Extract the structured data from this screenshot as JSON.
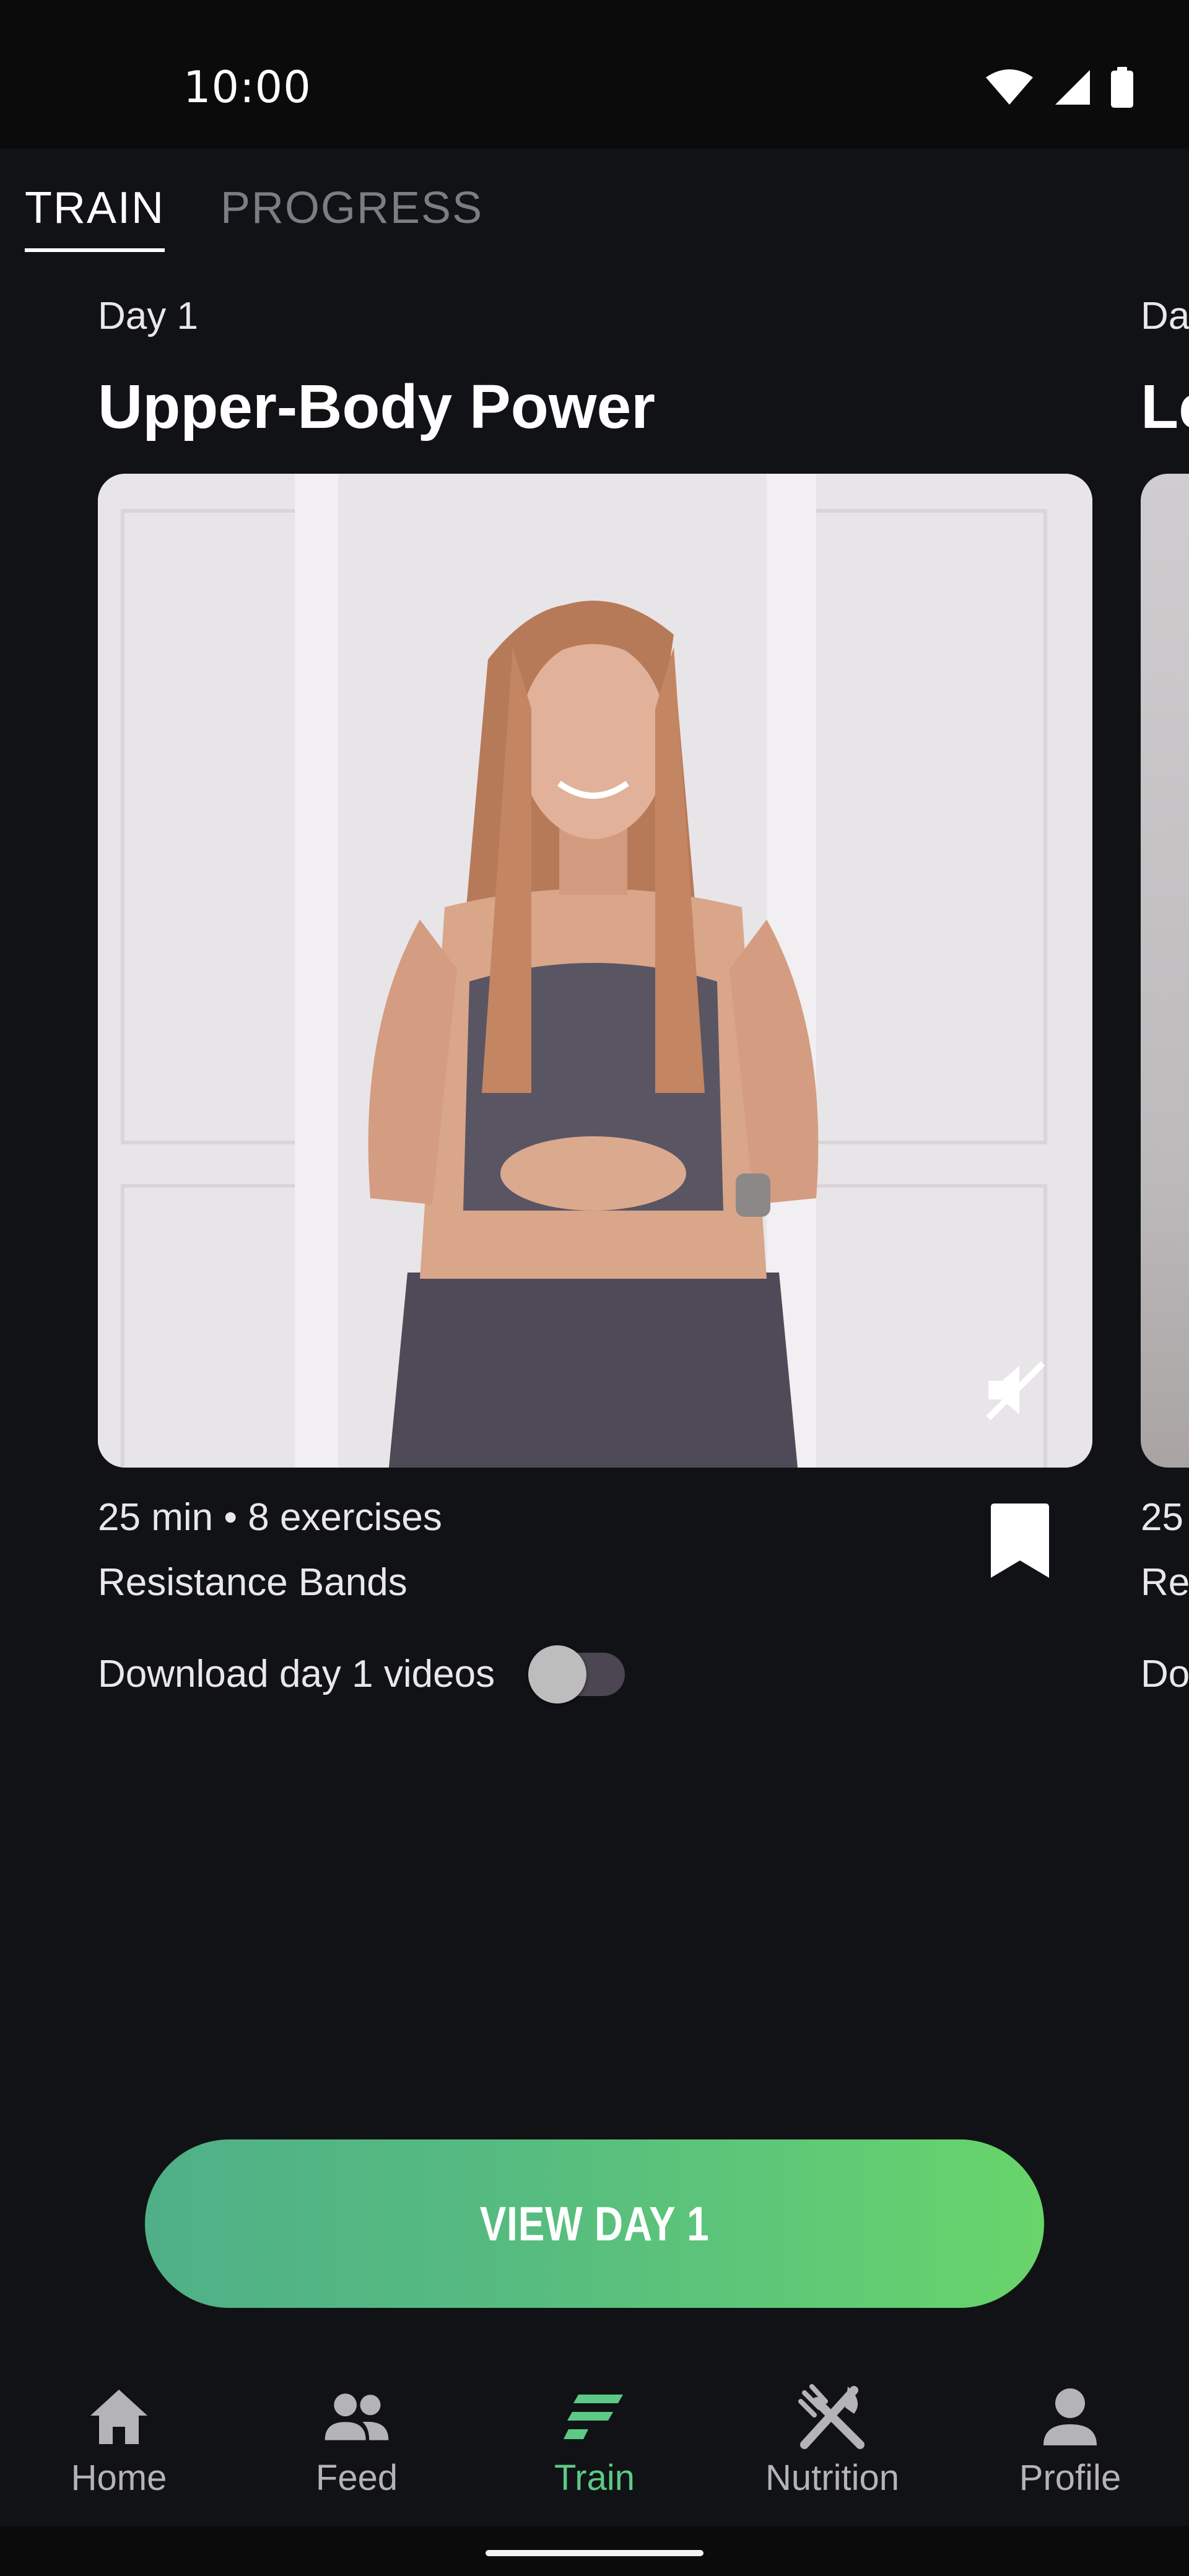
{
  "status_bar": {
    "time": "10:00",
    "icons": [
      "wifi-icon",
      "signal-icon",
      "battery-icon"
    ]
  },
  "top_tabs": [
    {
      "label": "TRAIN",
      "active": true
    },
    {
      "label": "PROGRESS",
      "active": false
    }
  ],
  "card": {
    "day_label": "Day 1",
    "title": "Upper-Body Power",
    "meta_duration": "25 min • 8 exercises",
    "meta_equipment": "Resistance Bands",
    "download_label": "Download day 1 videos",
    "download_enabled": false,
    "muted_icon": "volume-off-icon",
    "bookmark_icon": "bookmark-icon"
  },
  "next_card_peek": {
    "day_label": "Da",
    "title": "Le",
    "meta_duration": "25",
    "meta_equipment": "Re",
    "download_label": "Do"
  },
  "cta": {
    "label": "VIEW DAY 1"
  },
  "bottom_nav": [
    {
      "label": "Home",
      "icon": "home-icon",
      "active": false
    },
    {
      "label": "Feed",
      "icon": "people-icon",
      "active": false
    },
    {
      "label": "Train",
      "icon": "train-logo-icon",
      "active": true
    },
    {
      "label": "Nutrition",
      "icon": "fork-knife-icon",
      "active": false
    },
    {
      "label": "Profile",
      "icon": "person-icon",
      "active": false
    }
  ],
  "colors": {
    "accent": "#5cc986",
    "background": "#111215",
    "cta_start": "#4fb087",
    "cta_end": "#68d56a"
  }
}
